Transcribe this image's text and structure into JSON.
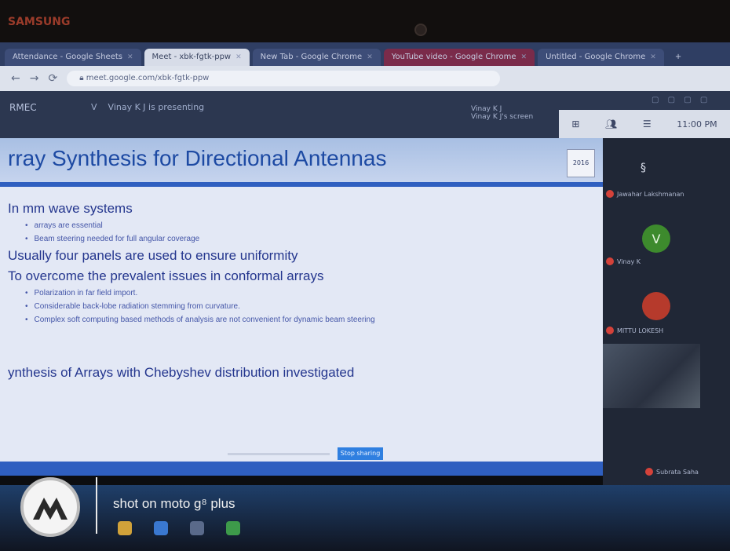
{
  "bezel": {
    "brand": "SAMSUNG"
  },
  "browser": {
    "tabs": [
      {
        "label": "Attendance - Google Sheets",
        "active": false
      },
      {
        "label": "Meet - xbk-fgtk-ppw",
        "active": true
      },
      {
        "label": "New Tab - Google Chrome",
        "active": false
      },
      {
        "label": "YouTube video - Google Chrome",
        "active": false
      },
      {
        "label": "Untitled - Google Chrome",
        "active": false
      }
    ],
    "url": "meet.google.com/xbk-fgtk-ppw"
  },
  "meet": {
    "brand": "RMEC",
    "presenter": "Vinay K J is presenting",
    "presenter_initial": "V",
    "chip_left": "Vinay K J",
    "chip_right": "Vinay K J's screen",
    "time": "11:00 PM"
  },
  "slide": {
    "title": "rray Synthesis for Directional Antennas",
    "logo_text": "2016",
    "headings": [
      "In mm wave systems",
      "Usually four panels are used to ensure uniformity",
      "To overcome the prevalent issues in conformal arrays",
      "ynthesis of Arrays with Chebyshev distribution investigated"
    ],
    "bullets_mm": [
      "arrays are essential",
      "Beam steering needed for full angular coverage"
    ],
    "bullets_conformal": [
      "Polarization in far field import.",
      "Considerable back-lobe radiation stemming from curvature.",
      "Complex soft computing based methods of analysis are not convenient for dynamic beam steering"
    ],
    "progress_label": "Stop sharing"
  },
  "participants": [
    {
      "name": "Jawahar Lakshmanan",
      "initial": ""
    },
    {
      "name": "Vinay K",
      "initial": "V"
    },
    {
      "name": "MITTU LOKESH",
      "initial": ""
    },
    {
      "name": "Video",
      "initial": ""
    },
    {
      "name": "Subrata Saha",
      "initial": ""
    }
  ],
  "footer": {
    "watermark": "shot on moto g⁸ plus"
  },
  "colors": {
    "slide_blue": "#2f5fc0",
    "title_blue": "#1d4aa3",
    "meet_green": "#3d8a2d",
    "mic_red": "#d4423a"
  }
}
